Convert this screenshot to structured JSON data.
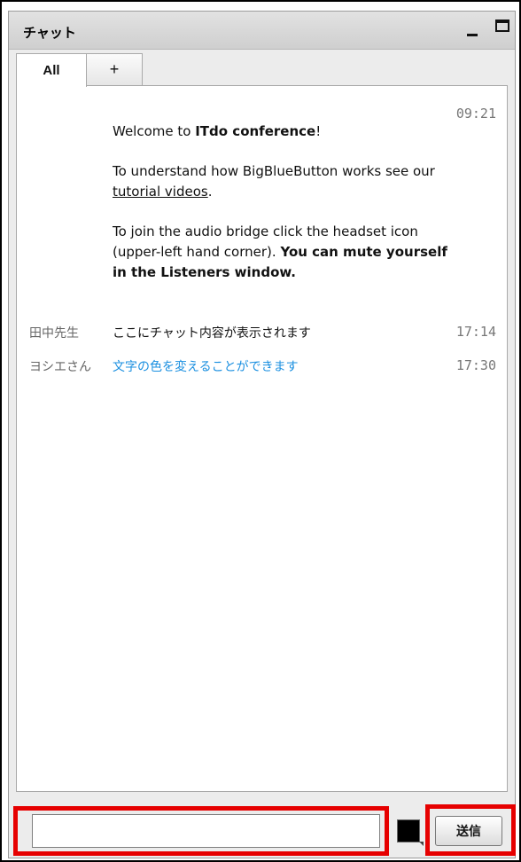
{
  "window": {
    "title": "チャット"
  },
  "tabs": [
    {
      "label": "All"
    },
    {
      "label": "+"
    }
  ],
  "welcome": {
    "time": "09:21",
    "line1_prefix": "Welcome to ",
    "line1_bold": "ITdo conference",
    "line1_suffix": "!",
    "line2_prefix": "To understand how BigBlueButton works see our ",
    "line2_link": "tutorial videos",
    "line2_suffix": ".",
    "line3": "To join the audio bridge click the headset icon (upper-left hand corner).",
    "line3_bold": "You can mute yourself in the Listeners window."
  },
  "messages": [
    {
      "sender": "田中先生",
      "text": "ここにチャット内容が表示されます",
      "time": "17:14",
      "color": "#111111"
    },
    {
      "sender": "ヨシエさん",
      "text": "文字の色を変えることができます",
      "time": "17:30",
      "color": "#1a8fe0"
    }
  ],
  "input": {
    "value": "",
    "placeholder": ""
  },
  "color_picker": {
    "color": "#000000"
  },
  "send_button": {
    "label": "送信"
  },
  "highlight_color": "#e60000"
}
